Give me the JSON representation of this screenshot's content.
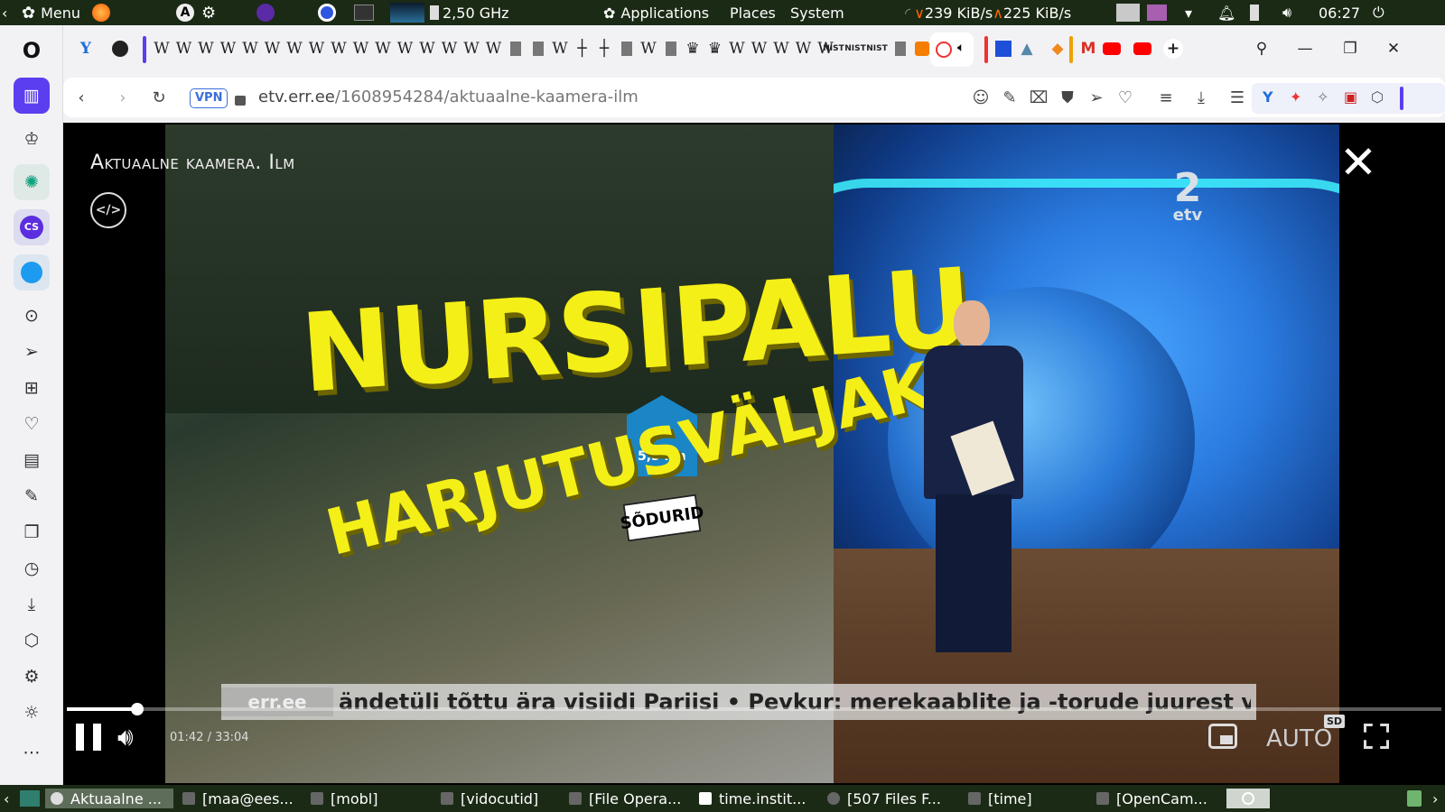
{
  "top_panel": {
    "menu_label": "Menu",
    "cpu_freq": "2,50 GHz",
    "applications": "Applications",
    "places": "Places",
    "system": "System",
    "net_down": "239 KiB/s",
    "net_up": "225 KiB/s",
    "clock": "06:27"
  },
  "tabs": {
    "w_glyph": "W",
    "nist": "NIST"
  },
  "address_bar": {
    "vpn_badge": "VPN",
    "url_host": "etv.err.ee",
    "url_path": "/1608954284/aktuaalne-kaamera-ilm"
  },
  "sidebar": {
    "cs_label": "CS"
  },
  "video": {
    "title": "Aktuaalne kaamera. Ilm",
    "headline_1": "NURSIPALU",
    "headline_2": "HARJUTUSVÄLJAK",
    "sign_text": "SÕDURID",
    "sign_distance": "5,5 km",
    "channel_logo_num": "2",
    "channel_logo_name": "etv",
    "ticker_source": "err.ee",
    "ticker_text": "ändetüli tõttu ära visiidi Pariisi   •   Pevkur: merekaablite ja -torude juurest võiks k",
    "time": "01:42 / 33:04",
    "progress": 0.051,
    "quality": "AUTO",
    "quality_badge": "SD"
  },
  "taskbar": {
    "items": [
      {
        "label": "Aktuaalne ..."
      },
      {
        "label": "[maa@ees..."
      },
      {
        "label": "[mobl]"
      },
      {
        "label": "[vidocutid]"
      },
      {
        "label": "[File Opera..."
      },
      {
        "label": "time.instit..."
      },
      {
        "label": "[507 Files F..."
      },
      {
        "label": "[time]"
      },
      {
        "label": "[OpenCam..."
      }
    ]
  }
}
